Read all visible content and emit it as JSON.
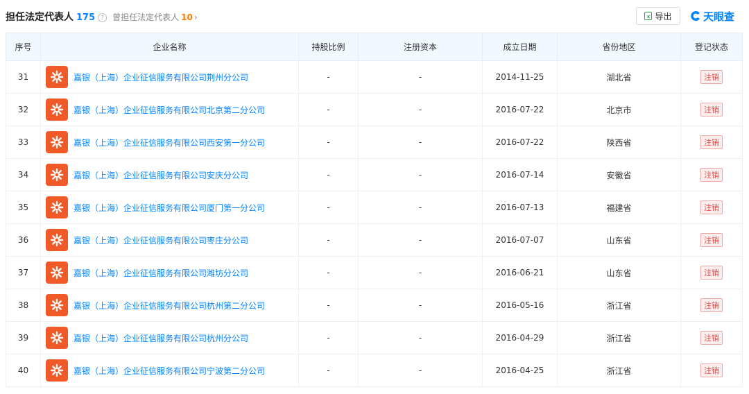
{
  "header": {
    "title": "担任法定代表人",
    "count": "175",
    "help_glyph": "?",
    "past_label": "曾担任法定代表人",
    "past_count": "10",
    "past_chevron": "›",
    "export_label": "导出",
    "export_icon_glyph": "x",
    "brand": "天眼查",
    "brand_color": "#0084ff"
  },
  "table": {
    "columns": [
      "序号",
      "企业名称",
      "持股比例",
      "注册资本",
      "成立日期",
      "省份地区",
      "登记状态"
    ],
    "rows": [
      {
        "no": "31",
        "name": "嘉银（上海）企业征信服务有限公司荆州分公司",
        "share": "-",
        "capital": "-",
        "date": "2014-11-25",
        "region": "湖北省",
        "status": "注销"
      },
      {
        "no": "32",
        "name": "嘉银（上海）企业征信服务有限公司北京第二分公司",
        "share": "-",
        "capital": "-",
        "date": "2016-07-22",
        "region": "北京市",
        "status": "注销"
      },
      {
        "no": "33",
        "name": "嘉银（上海）企业征信服务有限公司西安第一分公司",
        "share": "-",
        "capital": "-",
        "date": "2016-07-22",
        "region": "陕西省",
        "status": "注销"
      },
      {
        "no": "34",
        "name": "嘉银（上海）企业征信服务有限公司安庆分公司",
        "share": "-",
        "capital": "-",
        "date": "2016-07-14",
        "region": "安徽省",
        "status": "注销"
      },
      {
        "no": "35",
        "name": "嘉银（上海）企业征信服务有限公司厦门第一分公司",
        "share": "-",
        "capital": "-",
        "date": "2016-07-13",
        "region": "福建省",
        "status": "注销"
      },
      {
        "no": "36",
        "name": "嘉银（上海）企业征信服务有限公司枣庄分公司",
        "share": "-",
        "capital": "-",
        "date": "2016-07-07",
        "region": "山东省",
        "status": "注销"
      },
      {
        "no": "37",
        "name": "嘉银（上海）企业征信服务有限公司潍坊分公司",
        "share": "-",
        "capital": "-",
        "date": "2016-06-21",
        "region": "山东省",
        "status": "注销"
      },
      {
        "no": "38",
        "name": "嘉银（上海）企业征信服务有限公司杭州第二分公司",
        "share": "-",
        "capital": "-",
        "date": "2016-05-16",
        "region": "浙江省",
        "status": "注销"
      },
      {
        "no": "39",
        "name": "嘉银（上海）企业征信服务有限公司杭州分公司",
        "share": "-",
        "capital": "-",
        "date": "2016-04-29",
        "region": "浙江省",
        "status": "注销"
      },
      {
        "no": "40",
        "name": "嘉银（上海）企业征信服务有限公司宁波第二分公司",
        "share": "-",
        "capital": "-",
        "date": "2016-04-25",
        "region": "浙江省",
        "status": "注销"
      }
    ]
  },
  "colors": {
    "link": "#0084ff",
    "header_bg": "#f2f8ff",
    "status_red": "#f04444",
    "logo_orange": "#f05a28",
    "count_orange": "#ff7a00"
  }
}
